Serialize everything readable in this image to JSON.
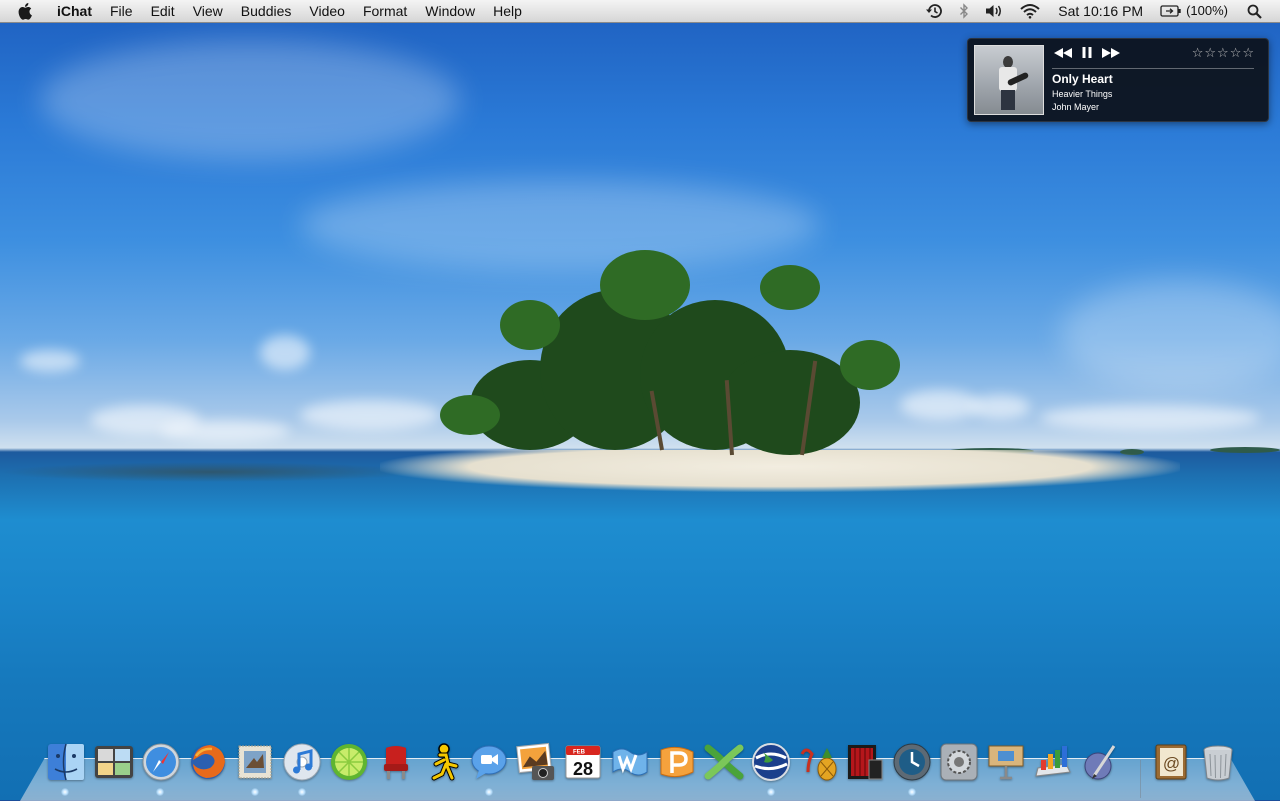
{
  "menubar": {
    "app_name": "iChat",
    "menus": [
      "File",
      "Edit",
      "View",
      "Buddies",
      "Video",
      "Format",
      "Window",
      "Help"
    ],
    "clock": "Sat 10:16 PM",
    "battery": "(100%)",
    "status_icons": [
      "time-machine-icon",
      "bluetooth-icon",
      "volume-icon",
      "wifi-icon",
      "battery-icon",
      "spotlight-icon"
    ]
  },
  "now_playing": {
    "title": "Only Heart",
    "album": "Heavier Things",
    "artist": "John Mayer",
    "rating_stars": 0,
    "rating_max": 5,
    "rating_glyph": "☆",
    "controls": [
      "previous-icon",
      "pause-icon",
      "next-icon"
    ]
  },
  "dock": {
    "apps": [
      "Finder",
      "Dashboard",
      "Safari",
      "Firefox",
      "Mail",
      "iTunes",
      "LimeWire",
      "Front Row",
      "AIM",
      "iChat",
      "iPhoto",
      "iCal",
      "Word",
      "PowerPoint",
      "Excel",
      "Google Earth",
      "Adium",
      "DVD Studio",
      "Time Machine",
      "System Preferences",
      "Keynote",
      "Numbers",
      "Script Editor",
      "Address Book",
      "Trash"
    ],
    "ical_day": "28",
    "ical_month": "FEB"
  },
  "colors": {
    "menubar": "#e6e6e6",
    "widget_bg": "#0c1018",
    "dock_glow": "#bfe3ff"
  }
}
